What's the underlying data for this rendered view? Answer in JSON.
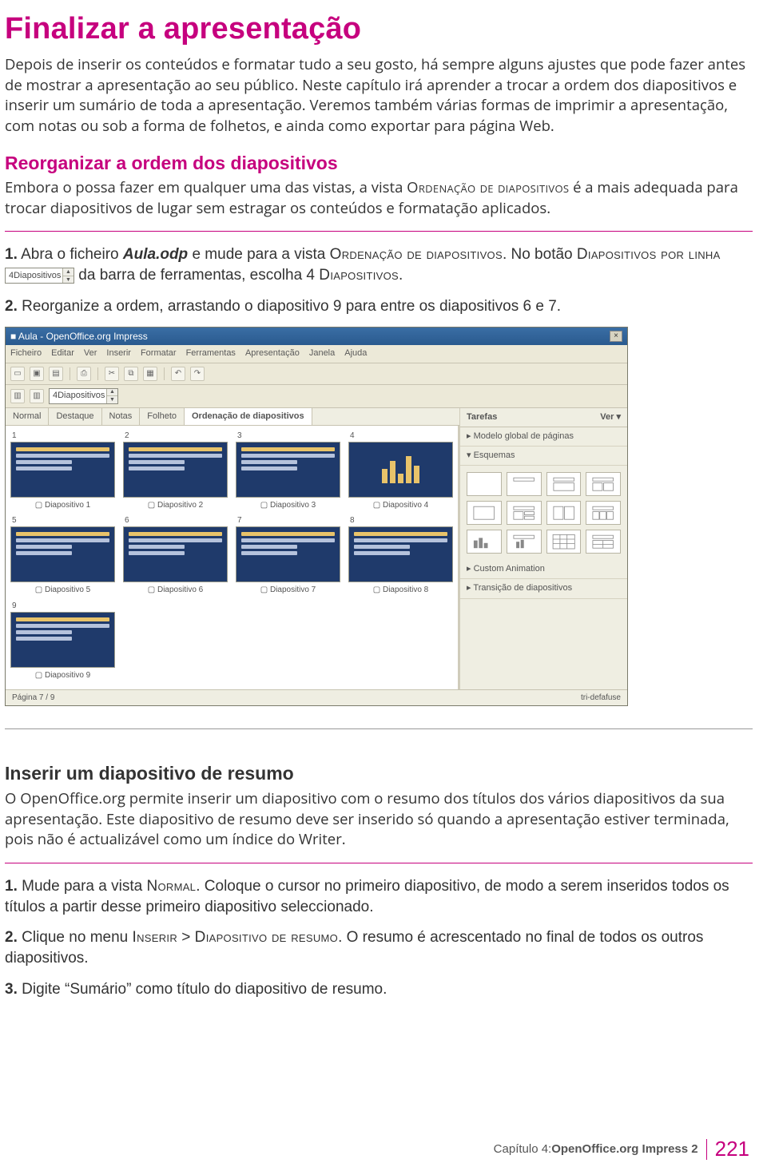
{
  "title": "Finalizar a apresentação",
  "intro": "Depois de inserir os conteúdos e formatar tudo a seu gosto, há sempre alguns ajustes que pode fazer antes de mostrar a apresentação ao seu público. Neste capítulo irá aprender a trocar a ordem dos diapositivos e inserir um sumário de toda a apresentação. Veremos também várias formas de imprimir a apresentação, com notas ou sob a forma de folhetos, e ainda como exportar para página Web.",
  "section1_heading": "Reorganizar a ordem dos diapositivos",
  "section1_body": "Embora o possa fazer em qualquer uma das vistas, a vista Ordenação de diapositivos é a mais adequada para trocar diapositivos de lugar sem estragar os conteúdos e formatação aplicados.",
  "step1": {
    "num": "1.",
    "a": " Abra o ficheiro ",
    "file": "Aula.odp",
    "b": " e mude para a vista ",
    "view": "Ordenação de diapositivos",
    "c": ". No botão ",
    "btn": "Diapositivos por linha",
    "spinner_value": "4Diapositivos",
    "d": " da barra de ferramentas, escolha 4 ",
    "e": "Diapositivos",
    "f": "."
  },
  "step2": {
    "num": "2.",
    "text": " Reorganize a ordem, arrastando o diapositivo 9 para entre os diapositivos 6 e 7."
  },
  "app": {
    "title": "Aula - OpenOffice.org Impress",
    "menubar": [
      "Ficheiro",
      "Editar",
      "Ver",
      "Inserir",
      "Formatar",
      "Ferramentas",
      "Apresentação",
      "Janela",
      "Ajuda"
    ],
    "spinner": "4Diapositivos",
    "tabs": [
      "Normal",
      "Destaque",
      "Notas",
      "Folheto",
      "Ordenação de diapositivos"
    ],
    "active_tab": 4,
    "slides": [
      {
        "n": "1",
        "cap": "Diapositivo 1"
      },
      {
        "n": "2",
        "cap": "Diapositivo 2"
      },
      {
        "n": "3",
        "cap": "Diapositivo 3"
      },
      {
        "n": "4",
        "cap": "Diapositivo 4",
        "chart": true
      },
      {
        "n": "5",
        "cap": "Diapositivo 5"
      },
      {
        "n": "6",
        "cap": "Diapositivo 6"
      },
      {
        "n": "7",
        "cap": "Diapositivo 7"
      },
      {
        "n": "8",
        "cap": "Diapositivo 8"
      },
      {
        "n": "9",
        "cap": "Diapositivo 9"
      }
    ],
    "taskpane": {
      "title": "Tarefas",
      "view": "Ver ▾",
      "sect_master": "▸ Modelo global de páginas",
      "sect_layouts": "▾ Esquemas",
      "sect_anim": "▸ Custom Animation",
      "sect_trans": "▸ Transição de diapositivos"
    },
    "status_left": "Página 7 / 9",
    "status_right": "tri-defafuse"
  },
  "section2_heading": "Inserir um diapositivo de resumo",
  "section2_body": "O OpenOffice.org permite inserir um diapositivo com o resumo dos títulos dos vários diapositivos da sua apresentação. Este diapositivo de resumo deve ser inserido só quando a apresentação estiver terminada, pois não é actualizável como um índice do Writer.",
  "step_b1": {
    "num": "1.",
    "a": " Mude para a vista ",
    "view": "Normal",
    "b": ". Coloque o cursor no primeiro diapositivo, de modo a serem inseridos todos os títulos a partir desse primeiro diapositivo seleccionado."
  },
  "step_b2": {
    "num": "2.",
    "a": " Clique no menu ",
    "m1": "Inserir",
    "gt": " > ",
    "m2": "Diapositivo de resumo",
    "b": ". O resumo é acrescentado no final de todos os outros diapositivos."
  },
  "step_b3": {
    "num": "3.",
    "text": " Digite “Sumário” como título do diapositivo de resumo."
  },
  "footer": {
    "chapter": "Capítulo 4: ",
    "book": "OpenOffice.org Impress 2",
    "page": "221"
  }
}
